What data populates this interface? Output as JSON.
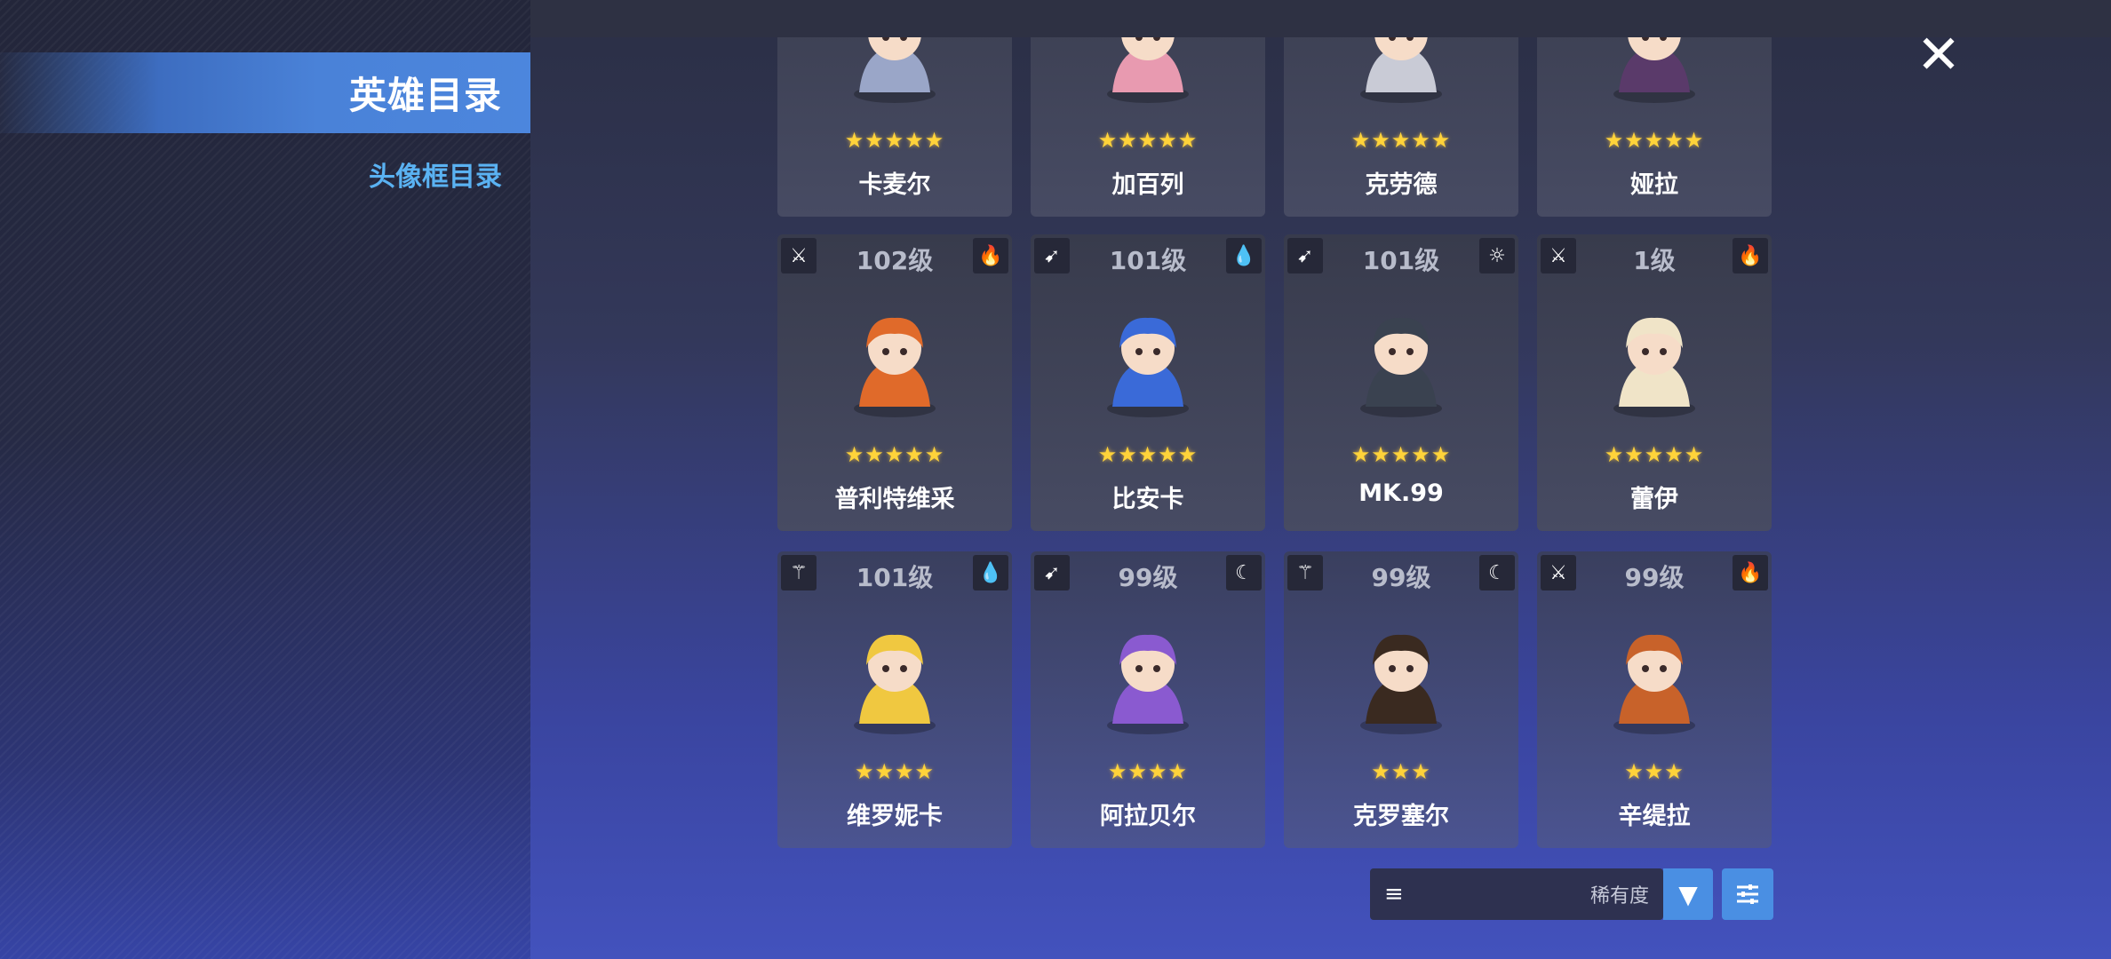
{
  "sidebar": {
    "active_tab": "英雄目录",
    "tab2": "头像框目录"
  },
  "close_label": "✕",
  "sort": {
    "menu_icon": "≡",
    "label": "稀有度",
    "dropdown_icon": "▼"
  },
  "heroes": [
    {
      "name": "卡麦尔",
      "level": "",
      "stars": "★★★★★",
      "class_icon": "",
      "element_icon": "",
      "color": "#9aa6c8"
    },
    {
      "name": "加百列",
      "level": "",
      "stars": "★★★★★",
      "class_icon": "",
      "element_icon": "",
      "color": "#e89ab0"
    },
    {
      "name": "克劳德",
      "level": "",
      "stars": "★★★★★",
      "class_icon": "",
      "element_icon": "",
      "color": "#c9cbd6"
    },
    {
      "name": "娅拉",
      "level": "",
      "stars": "★★★★★",
      "class_icon": "",
      "element_icon": "",
      "color": "#5a3a6a"
    },
    {
      "name": "普利特维采",
      "level": "102级",
      "stars": "★★★★★",
      "class_icon": "sword-icon",
      "element_icon": "fire-icon",
      "color": "#e06a2a"
    },
    {
      "name": "比安卡",
      "level": "101级",
      "stars": "★★★★★",
      "class_icon": "bow-icon",
      "element_icon": "water-icon",
      "color": "#3a6ad8"
    },
    {
      "name": "MK.99",
      "level": "101级",
      "stars": "★★★★★",
      "class_icon": "bow-icon",
      "element_icon": "light-icon",
      "color": "#3a4250"
    },
    {
      "name": "蕾伊",
      "level": "1级",
      "stars": "★★★★★",
      "class_icon": "sword-icon",
      "element_icon": "fire-icon",
      "color": "#f0e4c8"
    },
    {
      "name": "维罗妮卡",
      "level": "101级",
      "stars": "★★★★",
      "class_icon": "staff-icon",
      "element_icon": "water-icon",
      "color": "#f0c840"
    },
    {
      "name": "阿拉贝尔",
      "level": "99级",
      "stars": "★★★★",
      "class_icon": "bow-icon",
      "element_icon": "dark-icon",
      "color": "#8a5ad0"
    },
    {
      "name": "克罗塞尔",
      "level": "99级",
      "stars": "★★★",
      "class_icon": "staff-icon",
      "element_icon": "dark-icon",
      "color": "#3a2a20"
    },
    {
      "name": "辛缇拉",
      "level": "99级",
      "stars": "★★★",
      "class_icon": "sword-icon",
      "element_icon": "fire-icon",
      "color": "#c8622a"
    }
  ]
}
